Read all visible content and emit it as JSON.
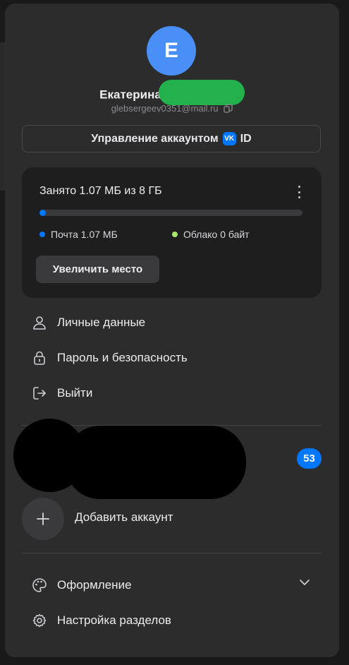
{
  "profile": {
    "avatar_letter": "Е",
    "name": "Екатерина",
    "email": "glebsergeev0351@mail.ru",
    "manage_label": "Управление аккаунтом",
    "vk_badge": "VK",
    "id_label": "ID"
  },
  "storage": {
    "title": "Занято 1.07 МБ из 8 ГБ",
    "used_fraction": 0.0001,
    "mail_label": "Почта 1.07 МБ",
    "cloud_label": "Облако 0 байт",
    "mail_color": "#0077ff",
    "cloud_color": "#a8e86b",
    "increase_label": "Увеличить место"
  },
  "menu": {
    "personal": "Личные данные",
    "password": "Пароль и безопасность",
    "logout": "Выйти"
  },
  "accounts": {
    "unread_count": "53",
    "add_label": "Добавить аккаунт"
  },
  "settings": {
    "appearance": "Оформление",
    "sections": "Настройка разделов"
  },
  "icons": [
    "copy-icon",
    "kebab-icon",
    "user-icon",
    "lock-icon",
    "logout-icon",
    "plus-icon",
    "palette-icon",
    "chevron-down-icon",
    "gear-icon"
  ]
}
